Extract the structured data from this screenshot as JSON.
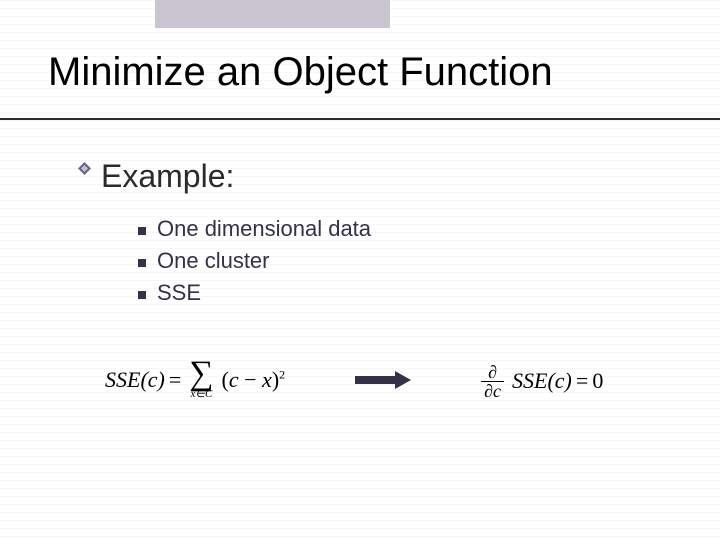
{
  "title": "Minimize an Object Function",
  "bullet": {
    "label": "Example:"
  },
  "sublist": {
    "items": [
      {
        "label": "One dimensional data"
      },
      {
        "label": "One cluster"
      },
      {
        "label": "SSE"
      }
    ]
  },
  "formulas": {
    "left": {
      "lhs": "SSE(c)",
      "equals": "=",
      "sum_sub": "x∈C",
      "term_open": "(",
      "term_c": "c",
      "term_minus": " − ",
      "term_x": "x",
      "term_close": ")",
      "exponent": "2"
    },
    "right": {
      "partial": "∂",
      "d_c": "∂c",
      "func": "SSE(c)",
      "equals": "=",
      "zero": "0"
    }
  }
}
